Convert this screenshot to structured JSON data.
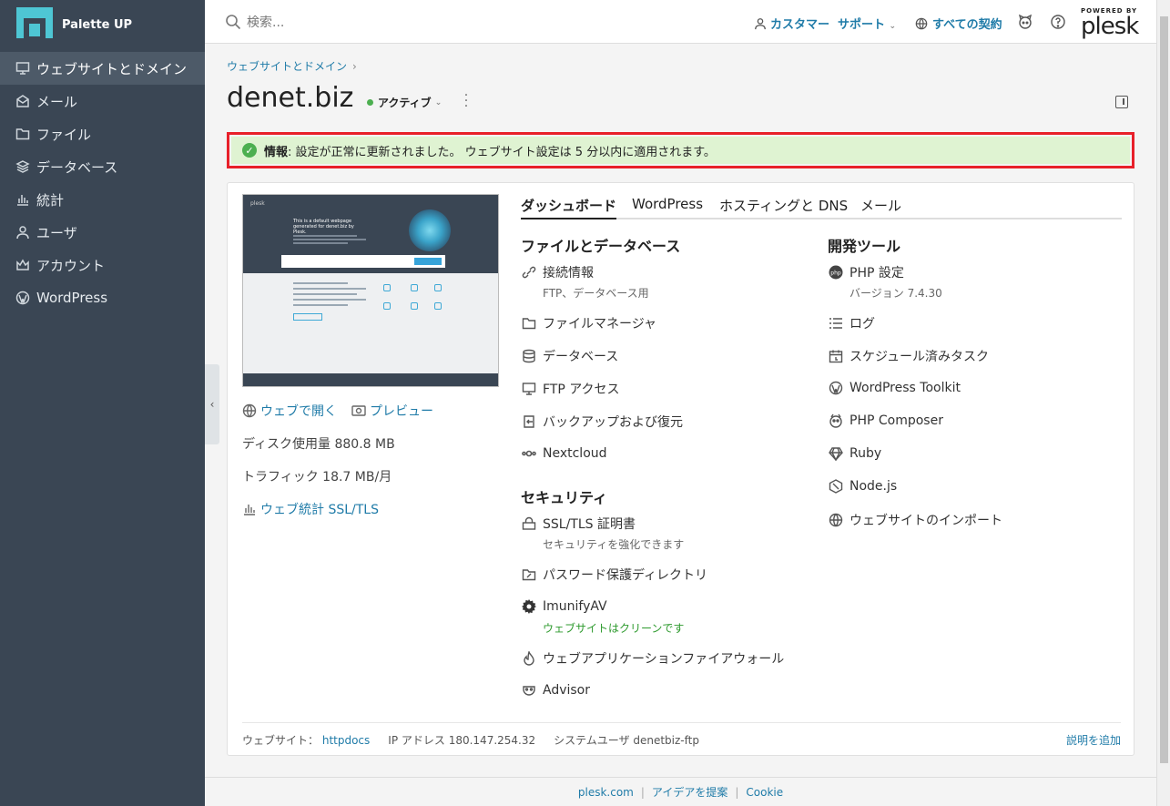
{
  "sidebar": {
    "app_name": "Palette UP",
    "items": [
      {
        "label": "ウェブサイトとドメイン",
        "icon": "monitor-icon"
      },
      {
        "label": "メール",
        "icon": "mail-icon"
      },
      {
        "label": "ファイル",
        "icon": "folder-icon"
      },
      {
        "label": "データベース",
        "icon": "layers-icon"
      },
      {
        "label": "統計",
        "icon": "bar-chart-icon"
      },
      {
        "label": "ユーザ",
        "icon": "user-icon"
      },
      {
        "label": "アカウント",
        "icon": "crown-icon"
      },
      {
        "label": "WordPress",
        "icon": "wordpress-icon"
      }
    ]
  },
  "topbar": {
    "search_placeholder": "検索...",
    "customer": "カスタマー",
    "support": "サポート",
    "contracts": "すべての契約",
    "powered_by": "POWERED BY",
    "brand": "plesk"
  },
  "page": {
    "breadcrumb": "ウェブサイトとドメイン",
    "domain": "denet.biz",
    "status": "アクティブ"
  },
  "notice": {
    "label": "情報",
    "message": ": 設定が正常に更新されました。 ウェブサイト設定は 5 分以内に適用されます。"
  },
  "left": {
    "thumbnail": {
      "brand": "plesk",
      "headline": "This is a default webpage generated for denet.biz by Plesk."
    },
    "open_web": "ウェブで開く",
    "preview": "プレビュー",
    "disk_label": "ディスク使用量 880.8 MB",
    "traffic_label": "トラフィック 18.7 MB/月",
    "web_stats": "ウェブ統計 SSL/TLS"
  },
  "tabs": [
    "ダッシュボード",
    "WordPress",
    "ホスティングと DNS",
    "メール"
  ],
  "sections": {
    "files": "ファイルとデータベース",
    "security": "セキュリティ",
    "dev": "開発ツール"
  },
  "files_items": [
    {
      "label": "接続情報",
      "sub": "FTP、データベース用",
      "icon": "link-icon"
    },
    {
      "label": "ファイルマネージャ",
      "icon": "folder-icon"
    },
    {
      "label": "データベース",
      "icon": "database-icon"
    },
    {
      "label": "FTP アクセス",
      "icon": "ftp-icon"
    },
    {
      "label": "バックアップおよび復元",
      "icon": "backup-icon"
    },
    {
      "label": "Nextcloud",
      "icon": "nextcloud-icon"
    }
  ],
  "security_items": [
    {
      "label": "SSL/TLS 証明書",
      "sub": "セキュリティを強化できます",
      "icon": "certificate-icon"
    },
    {
      "label": "パスワード保護ディレクトリ",
      "icon": "protected-folder-icon"
    },
    {
      "label": "ImunifyAV",
      "sub": "ウェブサイトはクリーンです",
      "icon": "gear-icon"
    },
    {
      "label": "ウェブアプリケーションファイアウォール",
      "icon": "flame-icon"
    },
    {
      "label": "Advisor",
      "icon": "advisor-icon"
    }
  ],
  "dev_items": [
    {
      "label": "PHP 設定",
      "sub": "バージョン 7.4.30",
      "icon": "php-icon"
    },
    {
      "label": "ログ",
      "icon": "list-icon"
    },
    {
      "label": "スケジュール済みタスク",
      "icon": "calendar-icon"
    },
    {
      "label": "WordPress Toolkit",
      "icon": "wordpress-icon"
    },
    {
      "label": "PHP Composer",
      "icon": "composer-icon"
    },
    {
      "label": "Ruby",
      "icon": "ruby-icon"
    },
    {
      "label": "Node.js",
      "icon": "nodejs-icon"
    },
    {
      "label": "ウェブサイトのインポート",
      "icon": "globe-import-icon"
    }
  ],
  "card_footer": {
    "website_label": "ウェブサイト：",
    "website_value": "httpdocs",
    "ip": "IP アドレス 180.147.254.32",
    "sysuser": "システムユーザ denetbiz-ftp",
    "add_desc": "説明を追加"
  },
  "footer": {
    "links": [
      "plesk.com",
      "アイデアを提案",
      "Cookie"
    ]
  }
}
